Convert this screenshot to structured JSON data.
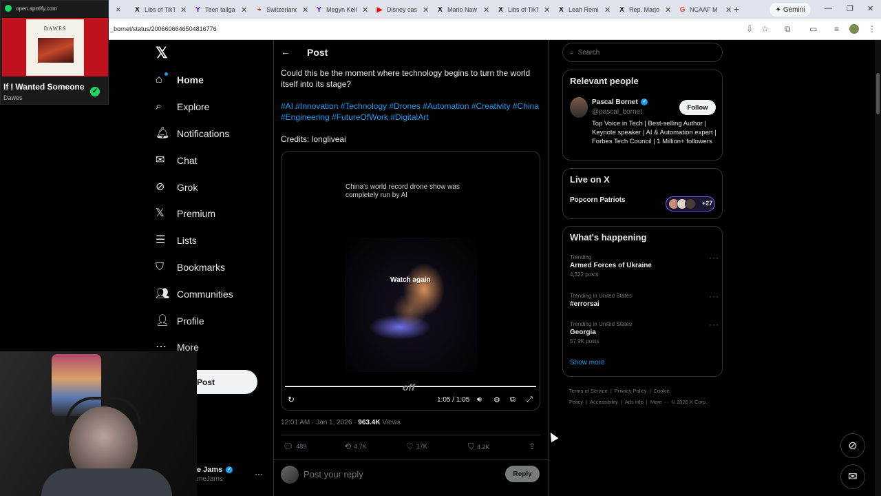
{
  "browser": {
    "tabs": [
      {
        "label": "Libs of TikT",
        "icon": "x-icon"
      },
      {
        "label": "Teen tailgat",
        "icon": "yahoo-icon"
      },
      {
        "label": "Switzerland",
        "icon": "swiss-icon"
      },
      {
        "label": "Megyn Kell",
        "icon": "yahoo-icon"
      },
      {
        "label": "Disney cast",
        "icon": "youtube-icon"
      },
      {
        "label": "Mario Naw",
        "icon": "x-icon"
      },
      {
        "label": "Libs of TikT",
        "icon": "x-icon"
      },
      {
        "label": "Leah Remin",
        "icon": "x-icon"
      },
      {
        "label": "Rep. Marjo",
        "icon": "x-icon"
      },
      {
        "label": "NCAAF M",
        "icon": "google-icon"
      }
    ],
    "new_tab": "+",
    "gemini_label": "Gemini",
    "url": "_bornet/status/2006606646504816776"
  },
  "spotify": {
    "url": "open.spotify.com",
    "cover_text": "DAWES",
    "title": "If I Wanted Someone",
    "artist": "Dawes"
  },
  "nav": {
    "items": [
      {
        "label": "Home",
        "icon": "home-icon"
      },
      {
        "label": "Explore",
        "icon": "search-icon"
      },
      {
        "label": "Notifications",
        "icon": "bell-icon"
      },
      {
        "label": "Chat",
        "icon": "mail-icon"
      },
      {
        "label": "Grok",
        "icon": "grok-icon"
      },
      {
        "label": "Premium",
        "icon": "x-icon"
      },
      {
        "label": "Lists",
        "icon": "list-icon"
      },
      {
        "label": "Bookmarks",
        "icon": "bookmark-icon"
      },
      {
        "label": "Communities",
        "icon": "people-icon"
      },
      {
        "label": "Profile",
        "icon": "person-icon"
      },
      {
        "label": "More",
        "icon": "more-icon"
      }
    ],
    "post_button": "Post",
    "me_name": "e Jams",
    "me_handle": "meJams"
  },
  "post": {
    "header": "Post",
    "text": "Could this be the moment where technology begins to turn the world itself into its stage?",
    "hashtags": "#AI #Innovation #Technology #Drones #Automation #Creativity #China #Engineering #FutureOfWork #DigitalArt",
    "credits": "Credits: longliveai",
    "video": {
      "caption": "China's world record drone show was completely run by AI",
      "watch_again": "Watch again",
      "overlay": "off",
      "time": "1:05 / 1:05"
    },
    "time": "12:01 AM · Jan 1, 2026 · ",
    "views_count": "963.4K",
    "views_label": " Views",
    "actions": {
      "replies": "489",
      "reposts": "4.7K",
      "likes": "17K",
      "bookmarks": "4.2K"
    },
    "reply_placeholder": "Post your reply",
    "reply_button": "Reply"
  },
  "sidebar": {
    "search_placeholder": "Search",
    "relevant": {
      "title": "Relevant people",
      "name": "Pascal Bornet",
      "handle": "@pascal_bornet",
      "follow": "Follow",
      "bio": "Top Voice in Tech | Best-selling Author | Keynote speaker | AI & Automation expert | Forbes Tech Council | 1 Million+ followers"
    },
    "live": {
      "title": "Live on X",
      "name": "Popcorn Patriots",
      "count": "+27"
    },
    "happening": {
      "title": "What's happening",
      "trends": [
        {
          "label": "Trending",
          "name": "Armed Forces of Ukraine",
          "count": "4,322 posts"
        },
        {
          "label": "Trending in United States",
          "name": "#errorsai",
          "count": ""
        },
        {
          "label": "Trending in United States",
          "name": "Georgia",
          "count": "57.9K posts"
        }
      ],
      "show_more": "Show more"
    },
    "footer": [
      "Terms of Service",
      "|",
      "Privacy Policy",
      "|",
      "Cookie Policy",
      "|",
      "Accessibility",
      "|",
      "Ads info",
      "|",
      "More ···",
      "© 2026 X Corp."
    ]
  }
}
